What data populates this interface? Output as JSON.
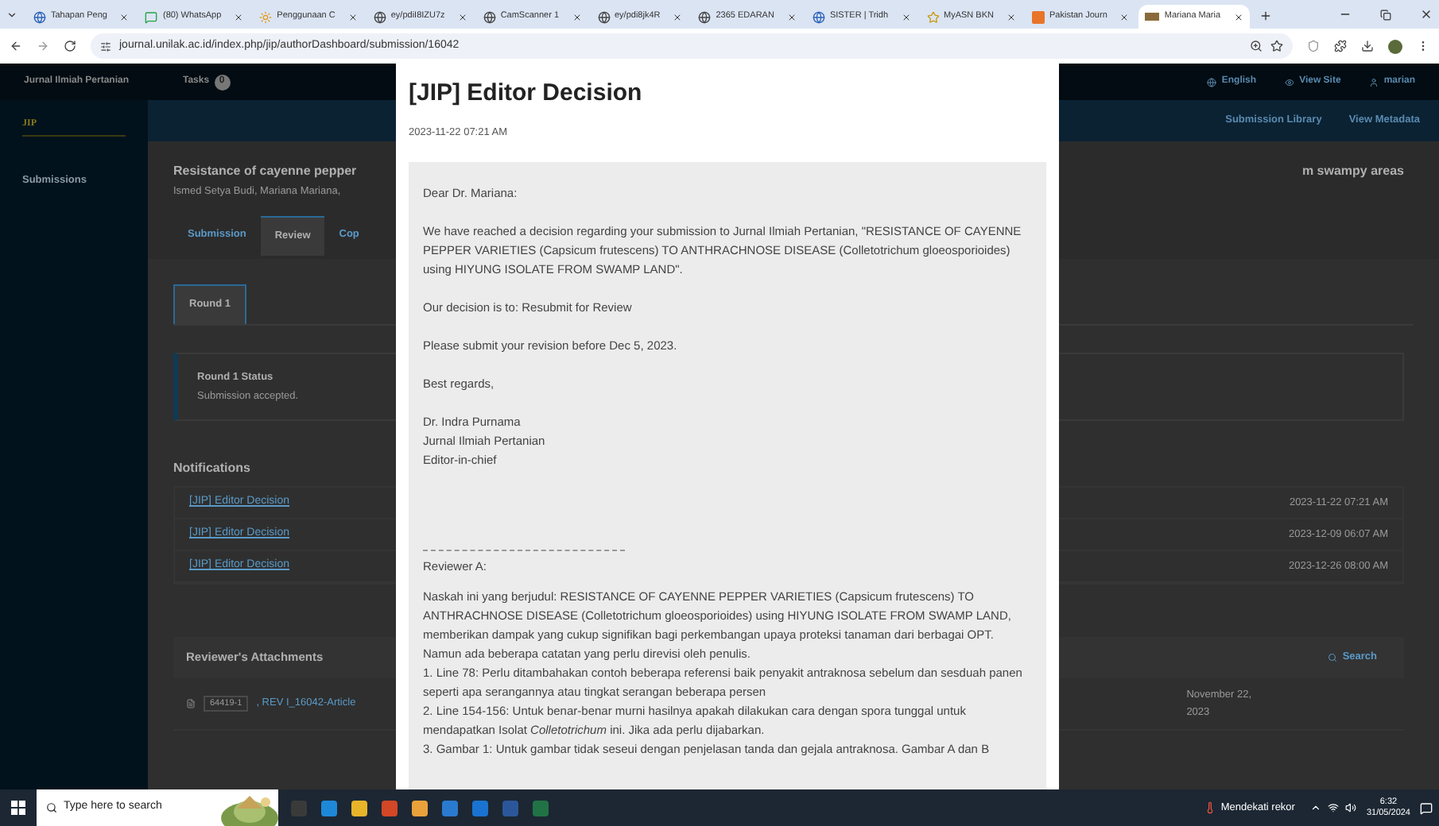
{
  "browser": {
    "tabs": [
      {
        "title": "Tahapan Peng",
        "kind": "web",
        "selected": false
      },
      {
        "title": "(80) WhatsApp",
        "kind": "chat",
        "selected": false
      },
      {
        "title": "Penggunaan C",
        "kind": "sun",
        "selected": false
      },
      {
        "title": "ey/pdiI8IZU7z",
        "kind": "globe",
        "selected": false
      },
      {
        "title": "CamScanner 1",
        "kind": "globe",
        "selected": false
      },
      {
        "title": "ey/pdi8jk4R",
        "kind": "globe",
        "selected": false
      },
      {
        "title": "2365 EDARAN",
        "kind": "globe",
        "selected": false
      },
      {
        "title": "SISTER | Tridh",
        "kind": "web",
        "selected": false
      },
      {
        "title": "MyASN BKN",
        "kind": "star",
        "selected": false
      },
      {
        "title": "Pakistan Journ",
        "kind": "tile",
        "selected": false
      },
      {
        "title": "Mariana Maria",
        "kind": "journal",
        "selected": true
      }
    ],
    "url": "journal.unilak.ac.id/index.php/jip/authorDashboard/submission/16042"
  },
  "app": {
    "site_title": "Jurnal Ilmiah Pertanian",
    "tasks_label": "Tasks",
    "tasks_count": "0",
    "logo": "JIP",
    "user_links": [
      {
        "kind": "language",
        "label": "English"
      },
      {
        "kind": "view",
        "label": "View Site"
      },
      {
        "kind": "user",
        "label": "marian"
      }
    ],
    "sidebar": [
      {
        "label": "Submissions"
      }
    ],
    "header_actions": [
      "Submission Library",
      "View Metadata"
    ],
    "title_left": "Resistance of cayenne pepper",
    "title_right": "m swampy areas",
    "authors": "Ismed Setya Budi, Mariana Mariana,",
    "tabs": [
      {
        "label": "Submission",
        "selected": false
      },
      {
        "label": "Review",
        "selected": true
      },
      {
        "label": "Cop",
        "selected": false
      }
    ],
    "round_tabs": [
      {
        "label": "Round 1",
        "selected": true
      }
    ],
    "status": {
      "title": "Round 1 Status",
      "text": "Submission accepted."
    },
    "notifications": {
      "title": "Notifications",
      "rows": [
        {
          "subject": "[JIP] Editor Decision",
          "date": "2023-11-22 07:21 AM"
        },
        {
          "subject": "[JIP] Editor Decision",
          "date": "2023-12-09 06:07 AM"
        },
        {
          "subject": "[JIP] Editor Decision",
          "date": "2023-12-26 08:00 AM"
        }
      ]
    },
    "attachments": {
      "title": "Reviewer's Attachments",
      "search": "Search",
      "rows": [
        {
          "id": "64419-1",
          "name": ", REV I_16042-Article",
          "date": "November 22, 2023"
        }
      ]
    }
  },
  "modal": {
    "title": "[JIP] Editor Decision",
    "date": "2023-11-22 07:21 AM",
    "paragraphs": [
      "Dear Dr. Mariana:",
      "We have reached a decision regarding your submission to Jurnal Ilmiah Pertanian, \"RESISTANCE OF CAYENNE PEPPER VARIETIES (Capsicum frutescens) TO ANTHRACHNOSE DISEASE (Colletotrichum gloeosporioides) using HIYUNG ISOLATE FROM SWAMP LAND\".",
      "Our decision is to: Resubmit for Review",
      "Please submit your revision before Dec 5, 2023.",
      "Best regards,"
    ],
    "signature": [
      "Dr. Indra Purnama",
      "Jurnal Ilmiah Pertanian",
      "Editor-in-chief"
    ],
    "reviewer_label": "Reviewer A:",
    "review_intro": "Naskah ini yang berjudul: RESISTANCE OF CAYENNE PEPPER VARIETIES (Capsicum frutescens) TO ANTHRACHNOSE DISEASE (Colletotrichum gloeosporioides) using HIYUNG ISOLATE FROM SWAMP LAND, memberikan dampak yang cukup signifikan bagi perkembangan upaya proteksi tanaman dari berbagai OPT. Namun ada beberapa catatan yang perlu direvisi oleh penulis.",
    "review_items": [
      "1. Line 78: Perlu ditambahakan contoh beberapa referensi baik penyakit antraknosa sebelum dan sesduah panen seperti apa serangannya atau tingkat serangan beberapa persen",
      "2. Line 154-156: Untuk benar-benar murni hasilnya apakah dilakukan cara dengan spora tunggal untuk mendapatkan Isolat *Colletotrichum* ini. Jika ada perlu dijabarkan.",
      "3. Gambar 1: Untuk gambar tidak seseui dengan penjelasan tanda dan gejala antraknosa. Gambar A dan B"
    ]
  },
  "taskbar": {
    "search_placeholder": "Type here to search",
    "weather": "Mendekati rekor",
    "time": "6:32",
    "date": "31/05/2024"
  }
}
